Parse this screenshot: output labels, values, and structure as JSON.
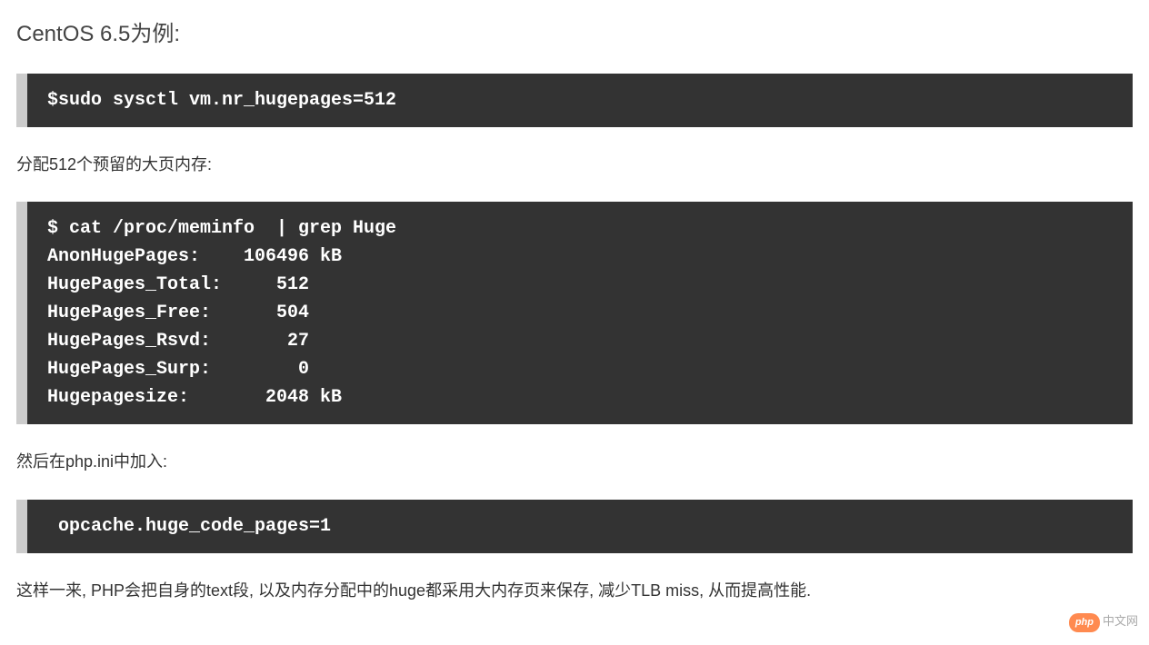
{
  "heading": "CentOS 6.5为例:",
  "code1": "$sudo sysctl vm.nr_hugepages=512",
  "para1": "分配512个预留的大页内存:",
  "code2": "$ cat /proc/meminfo  | grep Huge\nAnonHugePages:    106496 kB\nHugePages_Total:     512\nHugePages_Free:      504\nHugePages_Rsvd:       27\nHugePages_Surp:        0\nHugepagesize:       2048 kB",
  "para2": "然后在php.ini中加入:",
  "code3": " opcache.huge_code_pages=1",
  "para3": "这样一来, PHP会把自身的text段, 以及内存分配中的huge都采用大内存页来保存, 减少TLB miss, 从而提高性能.",
  "watermark": {
    "icon": "php",
    "text": "中文网"
  }
}
